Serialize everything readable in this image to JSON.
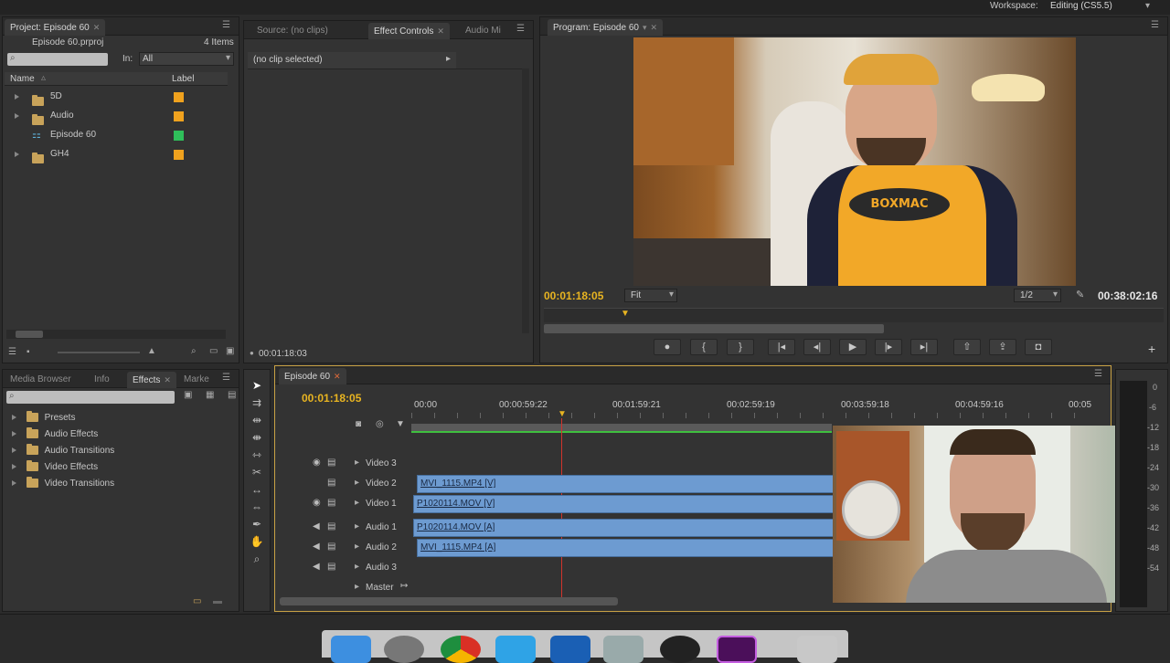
{
  "workspace": {
    "label": "Workspace:",
    "value": "Editing (CS5.5)"
  },
  "project": {
    "tab": "Project: Episode 60",
    "file": "Episode 60.prproj",
    "count": "4 Items",
    "in_label": "In:",
    "in_value": "All",
    "col_name": "Name",
    "col_label": "Label",
    "items": [
      {
        "name": "5D",
        "type": "folder",
        "color": "#f0a21e"
      },
      {
        "name": "Audio",
        "type": "folder",
        "color": "#f0a21e"
      },
      {
        "name": "Episode 60",
        "type": "sequence",
        "color": "#2fbf5a"
      },
      {
        "name": "GH4",
        "type": "folder",
        "color": "#f0a21e"
      }
    ]
  },
  "source": {
    "tabs": [
      "Source: (no clips)",
      "Effect Controls",
      "Audio Mi"
    ],
    "no_clip": "(no clip selected)",
    "timecode": "00:01:18:03"
  },
  "program": {
    "tab": "Program: Episode 60",
    "timecode_left": "00:01:18:05",
    "timecode_right": "00:38:02:16",
    "fit": "Fit",
    "resolution": "1/2",
    "shirt_text": "BOXMAC"
  },
  "effects": {
    "tabs": [
      "Media Browser",
      "Info",
      "Effects",
      "Marke"
    ],
    "items": [
      "Presets",
      "Audio Effects",
      "Audio Transitions",
      "Video Effects",
      "Video Transitions"
    ]
  },
  "timeline": {
    "tab": "Episode 60",
    "timecode": "00:01:18:05",
    "ruler": [
      "00:00",
      "00:00:59:22",
      "00:01:59:21",
      "00:02:59:19",
      "00:03:59:18",
      "00:04:59:16",
      "00:05"
    ],
    "tracks": [
      {
        "name": "Video 3",
        "clip": ""
      },
      {
        "name": "Video 2",
        "clip": "MVI_1115.MP4 [V]"
      },
      {
        "name": "Video 1",
        "clip": "P1020114.MOV [V]"
      },
      {
        "name": "Audio 1",
        "clip": "P1020114.MOV [A]"
      },
      {
        "name": "Audio 2",
        "clip": "MVI_1115.MP4 [A]"
      },
      {
        "name": "Audio 3",
        "clip": ""
      },
      {
        "name": "Master",
        "clip": ""
      }
    ]
  },
  "meter": {
    "labels": [
      "0",
      "-6",
      "-12",
      "-18",
      "-24",
      "-30",
      "-36",
      "-42",
      "-48",
      "-54"
    ]
  }
}
